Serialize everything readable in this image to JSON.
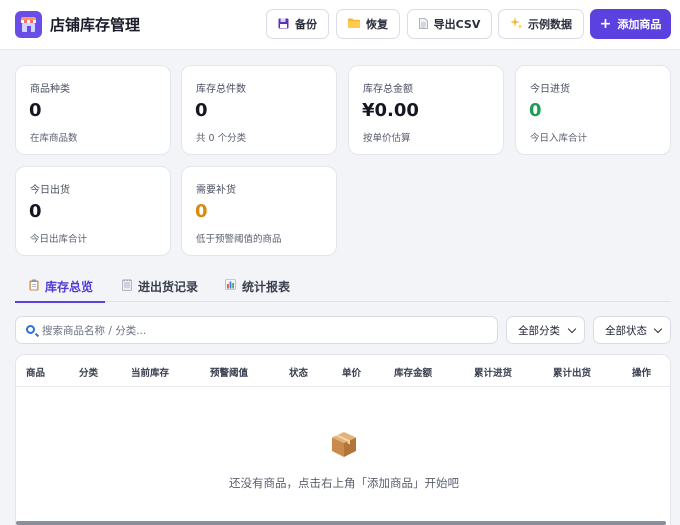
{
  "app": {
    "title": "店铺库存管理"
  },
  "toolbar": {
    "backup": {
      "icon": "floppy-disk-icon",
      "label": "备份"
    },
    "restore": {
      "icon": "folder-icon",
      "label": "恢复"
    },
    "export": {
      "icon": "document-icon",
      "label": "导出CSV"
    },
    "sample": {
      "icon": "sparkle-icon",
      "label": "示例数据"
    },
    "add": {
      "icon": "plus-icon",
      "label": "添加商品"
    }
  },
  "stats": [
    {
      "label": "商品种类",
      "value": "0",
      "sub": "在库商品数"
    },
    {
      "label": "库存总件数",
      "value": "0",
      "sub": "共 0 个分类"
    },
    {
      "label": "库存总金额",
      "value": "¥0.00",
      "sub": "按单价估算"
    },
    {
      "label": "今日进货",
      "value": "0",
      "sub": "今日入库合计",
      "color": "#1f9d55"
    },
    {
      "label": "今日出货",
      "value": "0",
      "sub": "今日出库合计"
    },
    {
      "label": "需要补货",
      "value": "0",
      "sub": "低于预警阈值的商品",
      "color": "#d98a0b"
    }
  ],
  "tabs": [
    {
      "icon": "clipboard-icon",
      "label": "库存总览",
      "active": true
    },
    {
      "icon": "notepad-icon",
      "label": "进出货记录",
      "active": false
    },
    {
      "icon": "bar-chart-icon",
      "label": "统计报表",
      "active": false
    }
  ],
  "filters": {
    "search_placeholder": "搜索商品名称 / 分类...",
    "category_selected": "全部分类",
    "status_selected": "全部状态"
  },
  "table": {
    "columns": [
      "商品",
      "分类",
      "当前库存",
      "预警阈值",
      "状态",
      "单价",
      "库存金额",
      "累计进货",
      "累计出货",
      "操作"
    ],
    "rows": [],
    "empty_icon": "package-box-icon",
    "empty_text": "还没有商品，点击右上角「添加商品」开始吧"
  },
  "colors": {
    "accent": "#5b41e0",
    "success": "#1f9d55",
    "warning": "#d98a0b"
  }
}
